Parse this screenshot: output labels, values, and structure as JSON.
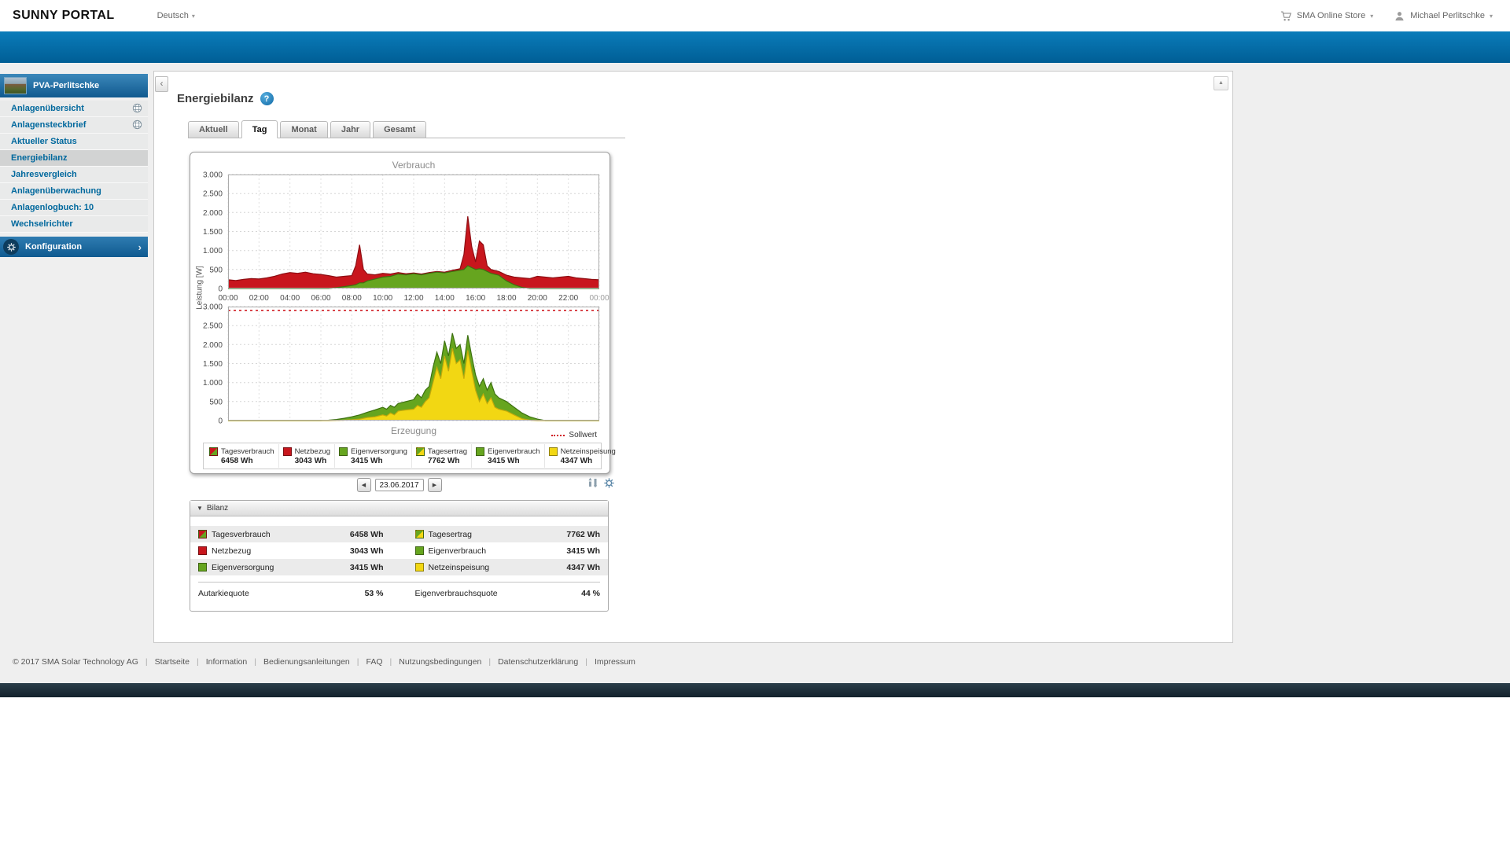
{
  "topbar": {
    "brand": "SUNNY PORTAL",
    "language": "Deutsch",
    "store": "SMA Online Store",
    "user": "Michael Perlitschke"
  },
  "sidebar": {
    "plant": "PVA-Perlitschke",
    "items": [
      {
        "label": "Anlagenübersicht"
      },
      {
        "label": "Anlagensteckbrief"
      },
      {
        "label": "Aktueller Status"
      },
      {
        "label": "Energiebilanz"
      },
      {
        "label": "Jahresvergleich"
      },
      {
        "label": "Anlagenüberwachung"
      },
      {
        "label": "Anlagenlogbuch: 10"
      },
      {
        "label": "Wechselrichter"
      }
    ],
    "config": "Konfiguration"
  },
  "main": {
    "title": "Energiebilanz",
    "tabs": [
      {
        "label": "Aktuell"
      },
      {
        "label": "Tag",
        "active": true
      },
      {
        "label": "Monat"
      },
      {
        "label": "Jahr"
      },
      {
        "label": "Gesamt"
      }
    ],
    "date": "23.06.2017",
    "legend": [
      {
        "name": "Tagesverbrauch",
        "value": "6458 Wh",
        "swatch": "red-green"
      },
      {
        "name": "Netzbezug",
        "value": "3043 Wh",
        "swatch": "red"
      },
      {
        "name": "Eigenversorgung",
        "value": "3415 Wh",
        "swatch": "green"
      },
      {
        "name": "Tagesertrag",
        "value": "7762 Wh",
        "swatch": "green-yellow"
      },
      {
        "name": "Eigenverbrauch",
        "value": "3415 Wh",
        "swatch": "green"
      },
      {
        "name": "Netzeinspeisung",
        "value": "4347 Wh",
        "swatch": "yellow"
      }
    ],
    "bilanz": {
      "title": "Bilanz",
      "left": [
        {
          "name": "Tagesverbrauch",
          "value": "6458 Wh",
          "swatch": "red-green"
        },
        {
          "name": "Netzbezug",
          "value": "3043 Wh",
          "swatch": "red"
        },
        {
          "name": "Eigenversorgung",
          "value": "3415 Wh",
          "swatch": "green"
        }
      ],
      "left_total": {
        "name": "Autarkiequote",
        "value": "53 %"
      },
      "right": [
        {
          "name": "Tagesertrag",
          "value": "7762 Wh",
          "swatch": "green-yellow"
        },
        {
          "name": "Eigenverbrauch",
          "value": "3415 Wh",
          "swatch": "green"
        },
        {
          "name": "Netzeinspeisung",
          "value": "4347 Wh",
          "swatch": "yellow"
        }
      ],
      "right_total": {
        "name": "Eigenverbrauchsquote",
        "value": "44 %"
      }
    }
  },
  "chart_data": {
    "type": "area",
    "unit": "W",
    "ylabel": "Leistung [W]",
    "sollwert_label": "Sollwert",
    "ylim": [
      0,
      3000
    ],
    "y_ticks": [
      0,
      500,
      1000,
      1500,
      2000,
      2500,
      3000
    ],
    "y_tick_labels": [
      "0",
      "500",
      "1.000",
      "1.500",
      "2.000",
      "2.500",
      "3.000"
    ],
    "x_ticks": [
      "00:00",
      "02:00",
      "04:00",
      "06:00",
      "08:00",
      "10:00",
      "12:00",
      "14:00",
      "16:00",
      "18:00",
      "20:00",
      "22:00",
      "00:00"
    ],
    "charts": [
      {
        "title": "Verbrauch",
        "x": [
          0,
          0.5,
          1,
          1.5,
          2,
          2.5,
          3,
          3.5,
          4,
          4.5,
          5,
          5.5,
          6,
          6.5,
          7,
          7.5,
          8,
          8.25,
          8.5,
          8.75,
          9,
          9.5,
          10,
          10.5,
          11,
          11.5,
          12,
          12.5,
          13,
          13.5,
          14,
          14.5,
          15,
          15.25,
          15.5,
          15.75,
          16,
          16.25,
          16.5,
          16.75,
          17,
          17.5,
          18,
          18.5,
          19,
          19.5,
          20,
          20.5,
          21,
          21.5,
          22,
          22.5,
          23,
          23.5,
          24
        ],
        "series": [
          {
            "name": "Tagesverbrauch (Netzbezug sichtbar)",
            "fill": "#c8161d",
            "stroke": "#8e0e13",
            "values": [
              230,
              210,
              240,
              260,
              250,
              280,
              320,
              380,
              420,
              400,
              430,
              390,
              370,
              340,
              300,
              320,
              340,
              600,
              1150,
              500,
              380,
              360,
              400,
              380,
              420,
              390,
              410,
              380,
              420,
              450,
              430,
              480,
              520,
              900,
              1900,
              1100,
              700,
              1250,
              1150,
              600,
              500,
              450,
              350,
              300,
              280,
              260,
              320,
              300,
              280,
              300,
              320,
              280,
              260,
              240,
              230
            ]
          },
          {
            "name": "Eigenversorgung",
            "fill": "#66a51f",
            "stroke": "#3d7110",
            "values": [
              0,
              0,
              0,
              0,
              0,
              0,
              0,
              0,
              0,
              0,
              0,
              0,
              0,
              0,
              20,
              50,
              80,
              100,
              150,
              150,
              200,
              250,
              300,
              320,
              380,
              360,
              390,
              360,
              400,
              430,
              410,
              450,
              480,
              500,
              600,
              550,
              500,
              520,
              500,
              450,
              400,
              350,
              200,
              100,
              30,
              0,
              0,
              0,
              0,
              0,
              0,
              0,
              0,
              0,
              0
            ]
          }
        ]
      },
      {
        "title": "Erzeugung",
        "sollwert": 2900,
        "x": [
          0,
          6,
          6.5,
          7,
          7.5,
          8,
          8.5,
          9,
          9.5,
          10,
          10.25,
          10.5,
          10.75,
          11,
          11.5,
          12,
          12.25,
          12.5,
          12.75,
          13,
          13.25,
          13.5,
          13.75,
          14,
          14.25,
          14.5,
          14.75,
          15,
          15.25,
          15.5,
          15.75,
          16,
          16.25,
          16.5,
          16.75,
          17,
          17.25,
          17.5,
          18,
          18.5,
          19,
          19.5,
          20,
          20.5,
          24
        ],
        "series": [
          {
            "name": "Tagesertrag (Eigenverbrauch sichtbar)",
            "fill": "#66a51f",
            "stroke": "#3d7110",
            "values": [
              0,
              0,
              10,
              30,
              60,
              100,
              150,
              220,
              280,
              350,
              300,
              400,
              350,
              450,
              500,
              550,
              700,
              600,
              800,
              900,
              1400,
              1800,
              1500,
              2100,
              1700,
              2300,
              1900,
              2000,
              1500,
              2250,
              1700,
              1200,
              900,
              1100,
              800,
              1000,
              700,
              600,
              500,
              350,
              200,
              100,
              40,
              0,
              0
            ]
          },
          {
            "name": "Netzeinspeisung",
            "fill": "#f2d713",
            "stroke": "#c3a90b",
            "values": [
              0,
              0,
              0,
              5,
              10,
              20,
              40,
              80,
              100,
              150,
              120,
              200,
              150,
              250,
              280,
              300,
              400,
              350,
              500,
              600,
              1000,
              1400,
              1100,
              1700,
              1300,
              1900,
              1500,
              1600,
              1100,
              1850,
              1300,
              800,
              500,
              700,
              450,
              600,
              350,
              300,
              250,
              150,
              50,
              10,
              0,
              0,
              0
            ]
          }
        ]
      }
    ]
  },
  "footer": {
    "copyright": "© 2017 SMA Solar Technology AG",
    "links": [
      "Startseite",
      "Information",
      "Bedienungsanleitungen",
      "FAQ",
      "Nutzungsbedingungen",
      "Datenschutzerklärung",
      "Impressum"
    ]
  },
  "colors": {
    "brand_blue": "#005e95",
    "consumption_red": "#c8161d",
    "self_green": "#66a51f",
    "feedin_yellow": "#f2d713"
  }
}
